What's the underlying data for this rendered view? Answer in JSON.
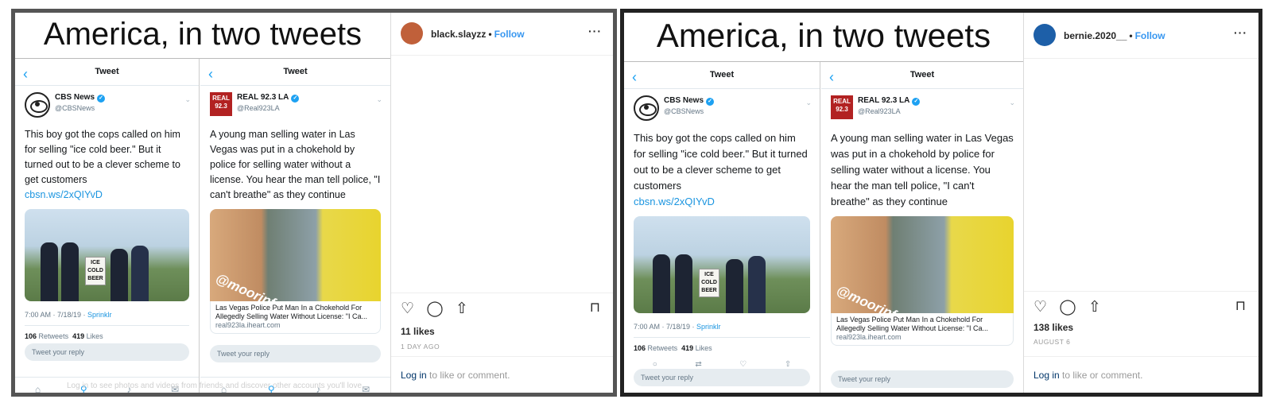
{
  "posts": [
    {
      "headline": "America, in two tweets",
      "tweets": [
        {
          "header_title": "Tweet",
          "name": "CBS News",
          "handle": "@CBSNews",
          "text": "This boy got the cops called on him for selling \"ice cold beer.\" But it turned out to be a clever scheme to get customers",
          "link": "cbsn.ws/2xQIYvD",
          "sign_text": "ICE COLD BEER",
          "meta_time": "7:00 AM · 7/18/19 · ",
          "meta_source": "Sprinklr",
          "retweets_count": "106",
          "retweets_label": "Retweets",
          "likes_count": "419",
          "likes_label": "Likes",
          "reply_placeholder": "Tweet your reply"
        },
        {
          "header_title": "Tweet",
          "name": "REAL 92.3 LA",
          "handle": "@Real923LA",
          "avatar_text": "REAL 92.3",
          "text": "A young man selling water in Las Vegas was put in a chokehold by police for selling water without a license. You hear the man tell police, \"I can't breathe\" as they continue",
          "watermark": "@moorinfoz",
          "card_title": "Las Vegas Police Put Man In a Chokehold For Allegedly Selling Water Without License: \"I Ca...",
          "card_domain": "real923la.iheart.com",
          "reply_placeholder": "Tweet your reply"
        }
      ],
      "instagram": {
        "username": "black.slayzz",
        "follow": "Follow",
        "likes": "11 likes",
        "date": "1 DAY AGO",
        "login_link": "Log in",
        "login_rest": " to like or comment.",
        "avatar_color": "#c0603a"
      }
    },
    {
      "headline": "America, in two tweets",
      "tweets": [
        {
          "header_title": "Tweet",
          "name": "CBS News",
          "handle": "@CBSNews",
          "text": "This boy got the cops called on him for selling \"ice cold beer.\" But it turned out to be a clever scheme to get customers",
          "link": "cbsn.ws/2xQIYvD",
          "sign_text": "ICE COLD BEER",
          "meta_time": "7:00 AM · 7/18/19 · ",
          "meta_source": "Sprinklr",
          "retweets_count": "106",
          "retweets_label": "Retweets",
          "likes_count": "419",
          "likes_label": "Likes",
          "reply_placeholder": "Tweet your reply"
        },
        {
          "header_title": "Tweet",
          "name": "REAL 92.3 LA",
          "handle": "@Real923LA",
          "avatar_text": "REAL 92.3",
          "text": "A young man selling water in Las Vegas was put in a chokehold by police for selling water without a license. You hear the man tell police, \"I can't breathe\" as they continue",
          "watermark": "@moorinfoz",
          "card_title": "Las Vegas Police Put Man In a Chokehold For Allegedly Selling Water Without License: \"I Ca...",
          "card_domain": "real923la.iheart.com",
          "reply_placeholder": "Tweet your reply"
        }
      ],
      "instagram": {
        "username": "bernie.2020__",
        "follow": "Follow",
        "likes": "138 likes",
        "date": "AUGUST 6",
        "login_link": "Log in",
        "login_rest": " to like or comment.",
        "avatar_color": "#1d5fa8"
      }
    }
  ],
  "footer_text": "Log in to see photos and videos from friends and discover other accounts you'll love."
}
